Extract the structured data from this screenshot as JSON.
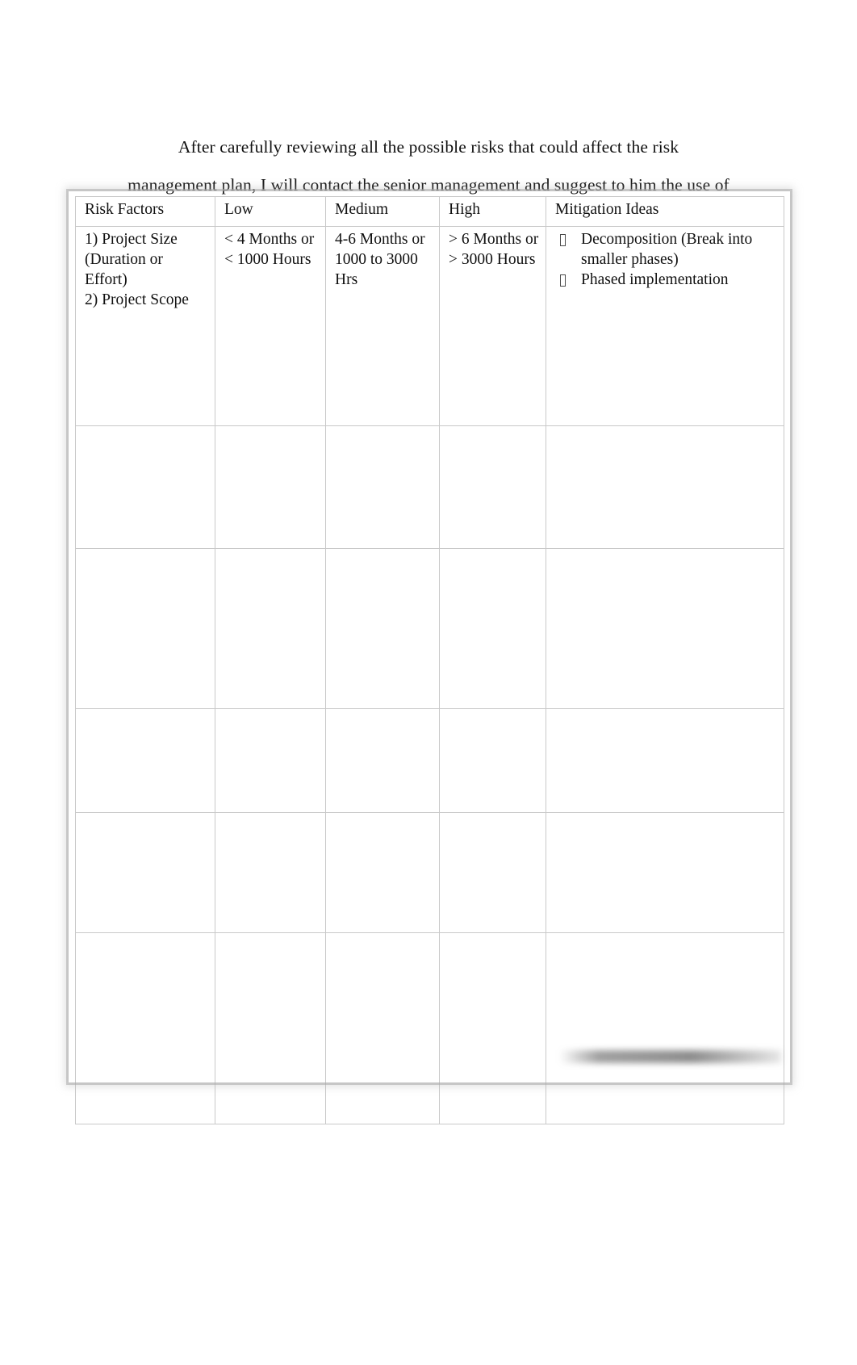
{
  "document": {
    "intro_line_1": "After carefully reviewing all the possible risks that could affect the risk",
    "intro_line_2": "management plan, I will contact the senior management and suggest to him the use of"
  },
  "table": {
    "headers": {
      "risk_factors": "Risk Factors",
      "low": "Low",
      "medium": "Medium",
      "high": "High",
      "mitigation": "Mitigation Ideas"
    },
    "rows": [
      {
        "factor_line_1": "1) Project Size",
        "factor_line_2": "(Duration or",
        "factor_line_3": "Effort)",
        "factor_line_4": "2) Project Scope",
        "low_line_1": "< 4 Months or",
        "low_line_2": "< 1000 Hours",
        "medium_line_1": "4-6 Months or",
        "medium_line_2": "1000 to 3000",
        "medium_line_3": "Hrs",
        "high_line_1": "> 6 Months or",
        "high_line_2": "> 3000 Hours",
        "mitigation": [
          "Decomposition (Break into smaller phases)",
          "Phased implementation"
        ]
      }
    ]
  },
  "bullet_glyph": "missing-glyph-box"
}
